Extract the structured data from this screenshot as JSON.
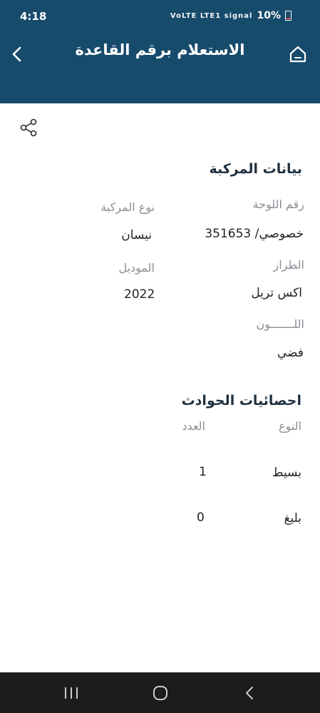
{
  "status": {
    "time": "4:18",
    "battery": "10%",
    "icons": "VoLTE LTE1 signal"
  },
  "header": {
    "title": "الاستعلام برقم القاعدة"
  },
  "vehicle": {
    "section_title": "بيانات المركبة",
    "plate_label": "رقم اللوحة",
    "plate_value": "خصوصي/ 351653",
    "type_label": "نوع المركبة",
    "type_value": "نيسان",
    "model_name_label": "الطراز",
    "model_name_value": "اكس تريل",
    "year_label": "الموديل",
    "year_value": "2022",
    "color_label": "اللـــــــون",
    "color_value": "فضي"
  },
  "accidents": {
    "section_title": "احصائيات الحوادث",
    "col_type": "النوع",
    "col_count": "العدد",
    "rows": [
      {
        "type": "بسيط",
        "count": "1"
      },
      {
        "type": "بليغ",
        "count": "0"
      }
    ]
  },
  "colors": {
    "header_bg": "#174b6c",
    "nav_bg": "#1c1c1c"
  }
}
